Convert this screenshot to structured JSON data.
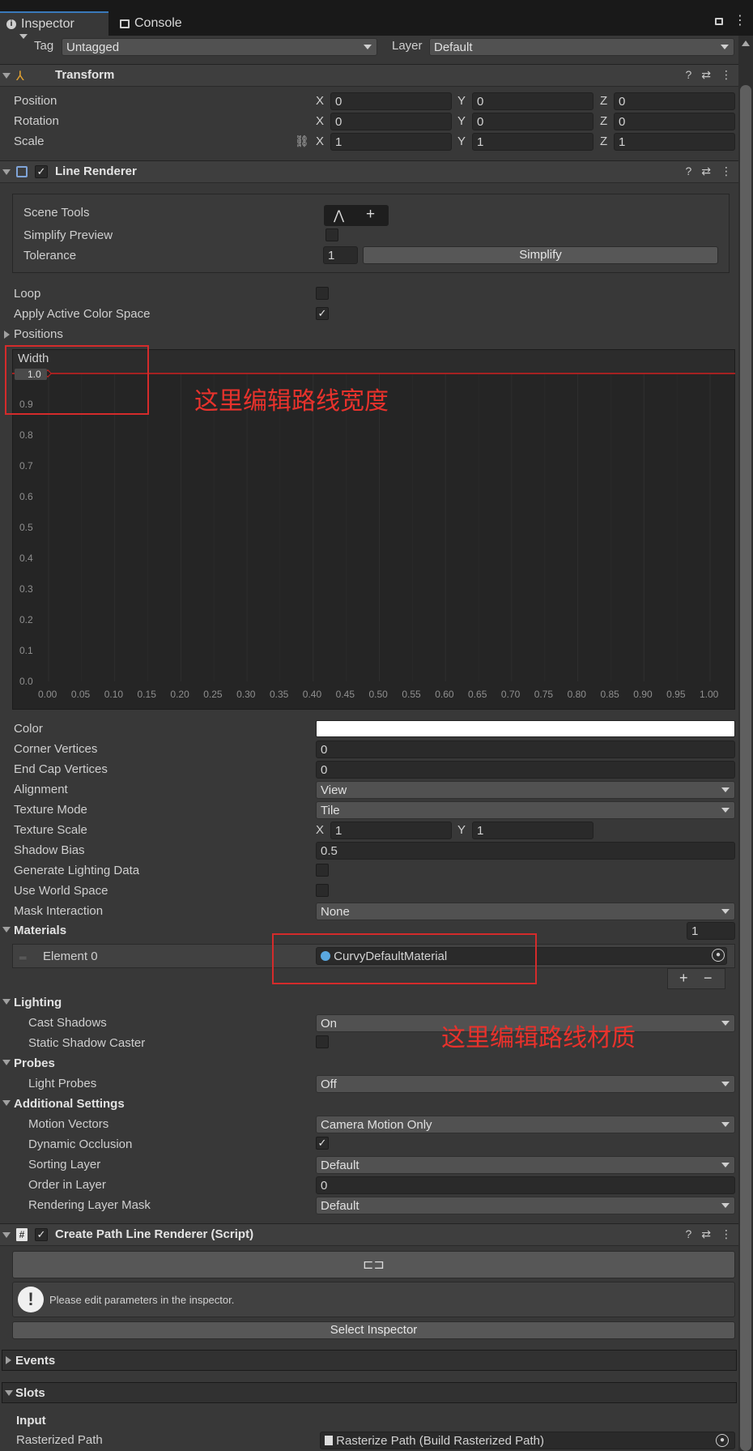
{
  "tabs": {
    "inspector": "Inspector",
    "console": "Console"
  },
  "top": {
    "tag_label": "Tag",
    "tag_value": "Untagged",
    "layer_label": "Layer",
    "layer_value": "Default"
  },
  "transform": {
    "title": "Transform",
    "position_label": "Position",
    "rotation_label": "Rotation",
    "scale_label": "Scale",
    "position": {
      "x": "0",
      "y": "0",
      "z": "0"
    },
    "rotation": {
      "x": "0",
      "y": "0",
      "z": "0"
    },
    "scale": {
      "x": "1",
      "y": "1",
      "z": "1"
    },
    "axes": {
      "x": "X",
      "y": "Y",
      "z": "Z"
    }
  },
  "line_renderer": {
    "title": "Line Renderer",
    "scene_tools_label": "Scene Tools",
    "simplify_preview_label": "Simplify Preview",
    "tolerance_label": "Tolerance",
    "tolerance_value": "1",
    "simplify_button": "Simplify",
    "loop_label": "Loop",
    "apply_color_space_label": "Apply Active Color Space",
    "positions_label": "Positions",
    "width_label": "Width",
    "width_top_value": "1.0",
    "color_label": "Color",
    "corner_vertices_label": "Corner Vertices",
    "corner_vertices": "0",
    "end_cap_vertices_label": "End Cap Vertices",
    "end_cap_vertices": "0",
    "alignment_label": "Alignment",
    "alignment": "View",
    "texture_mode_label": "Texture Mode",
    "texture_mode": "Tile",
    "texture_scale_label": "Texture Scale",
    "texture_scale_x": "1",
    "texture_scale_y": "1",
    "shadow_bias_label": "Shadow Bias",
    "shadow_bias": "0.5",
    "gen_lighting_label": "Generate Lighting Data",
    "use_world_space_label": "Use World Space",
    "mask_interaction_label": "Mask Interaction",
    "mask_interaction": "None",
    "materials_label": "Materials",
    "materials_count": "1",
    "element0_label": "Element 0",
    "element0_value": "CurvyDefaultMaterial",
    "lighting_label": "Lighting",
    "cast_shadows_label": "Cast Shadows",
    "cast_shadows": "On",
    "static_shadow_label": "Static Shadow Caster",
    "probes_label": "Probes",
    "light_probes_label": "Light Probes",
    "light_probes": "Off",
    "additional_label": "Additional Settings",
    "motion_vectors_label": "Motion Vectors",
    "motion_vectors": "Camera Motion Only",
    "dynamic_occlusion_label": "Dynamic Occlusion",
    "sorting_layer_label": "Sorting Layer",
    "sorting_layer": "Default",
    "order_in_layer_label": "Order in Layer",
    "order_in_layer": "0",
    "rendering_mask_label": "Rendering Layer Mask",
    "rendering_mask": "Default"
  },
  "width_curve": {
    "y_ticks": [
      "0.9",
      "0.8",
      "0.7",
      "0.6",
      "0.5",
      "0.4",
      "0.3",
      "0.2",
      "0.1",
      "0.0"
    ],
    "x_ticks": [
      "0.00",
      "0.05",
      "0.10",
      "0.15",
      "0.20",
      "0.25",
      "0.30",
      "0.35",
      "0.40",
      "0.45",
      "0.50",
      "0.55",
      "0.60",
      "0.65",
      "0.70",
      "0.75",
      "0.80",
      "0.85",
      "0.90",
      "0.95",
      "1.00"
    ],
    "curve_value": 1.0,
    "line_color": "#d02020"
  },
  "script": {
    "title": "Create Path Line Renderer (Script)",
    "help_text": "Please edit parameters in the inspector.",
    "select_inspector": "Select Inspector",
    "events_label": "Events",
    "slots_label": "Slots",
    "input_label": "Input",
    "rasterized_path_label": "Rasterized Path",
    "rasterized_path_value": "Rasterize Path (Build Rasterized Path)"
  },
  "annotations": {
    "width_note": "这里编辑路线宽度",
    "material_note": "这里编辑路线材质",
    "color": "#d42b2b"
  }
}
